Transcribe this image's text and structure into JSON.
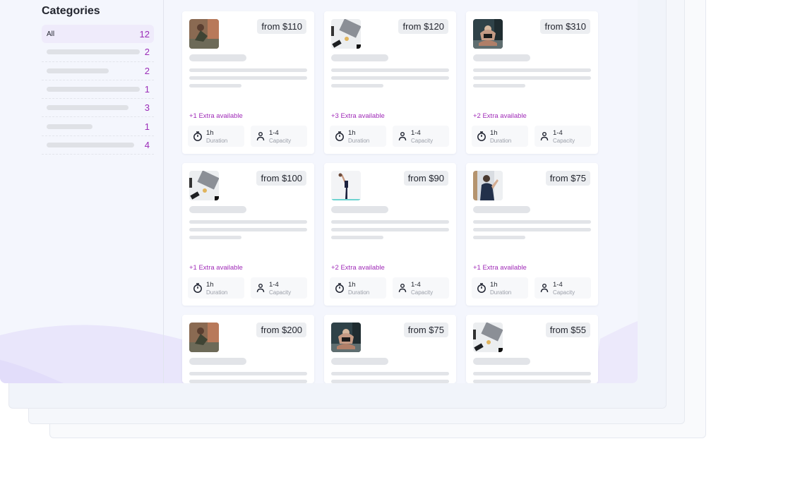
{
  "sidebar": {
    "title": "Categories",
    "items": [
      {
        "label": "All",
        "count": "12",
        "active": true
      },
      {
        "label": "",
        "count": "2",
        "bar": 0.85
      },
      {
        "label": "",
        "count": "2",
        "bar": 0.57
      },
      {
        "label": "",
        "count": "1",
        "bar": 0.85
      },
      {
        "label": "",
        "count": "3",
        "bar": 0.75
      },
      {
        "label": "",
        "count": "1",
        "bar": 0.42
      },
      {
        "label": "",
        "count": "4",
        "bar": 0.8
      }
    ]
  },
  "meta_labels": {
    "duration": "Duration",
    "capacity": "Capacity"
  },
  "cards": [
    {
      "price": "from $110",
      "extra": "+1 Extra available",
      "duration": "1h",
      "capacity": "1-4",
      "image": "yoga-floor-photo"
    },
    {
      "price": "from $120",
      "extra": "+3 Extra available",
      "duration": "1h",
      "capacity": "1-4",
      "image": "laptop-desk-photo"
    },
    {
      "price": "from $310",
      "extra": "+2 Extra available",
      "duration": "1h",
      "capacity": "1-4",
      "image": "gym-situp-photo"
    },
    {
      "price": "from $100",
      "extra": "+1 Extra available",
      "duration": "1h",
      "capacity": "1-4",
      "image": "laptop-desk-photo"
    },
    {
      "price": "from $90",
      "extra": "+2 Extra available",
      "duration": "1h",
      "capacity": "1-4",
      "image": "yoga-stretch-photo"
    },
    {
      "price": "from $75",
      "extra": "+1 Extra available",
      "duration": "1h",
      "capacity": "1-4",
      "image": "gym-mirror-photo"
    },
    {
      "price": "from $200",
      "extra": "",
      "duration": "",
      "capacity": "",
      "image": "yoga-floor-photo"
    },
    {
      "price": "from $75",
      "extra": "",
      "duration": "",
      "capacity": "",
      "image": "gym-situp-photo"
    },
    {
      "price": "from $55",
      "extra": "",
      "duration": "",
      "capacity": "",
      "image": "laptop-desk-photo"
    }
  ]
}
